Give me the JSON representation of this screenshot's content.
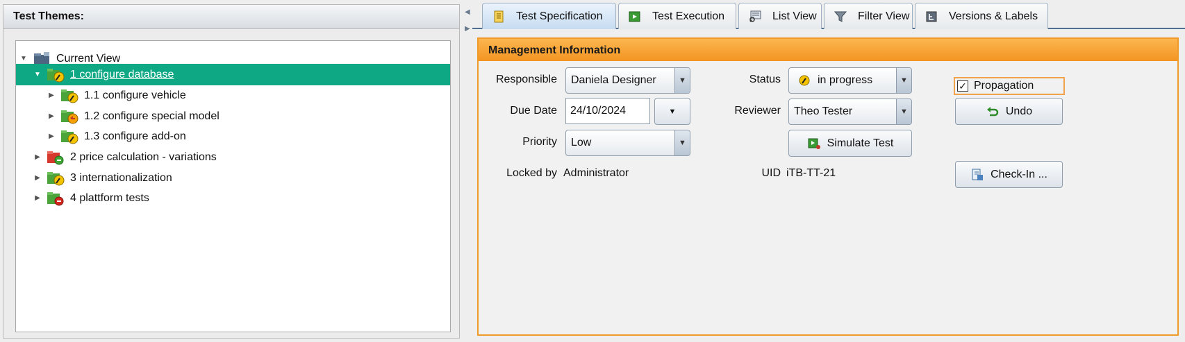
{
  "left_panel": {
    "title": "Test Themes:",
    "tree": [
      {
        "label": "Current View",
        "expanded": "▼",
        "icon": "view-icon"
      },
      {
        "label": "1 configure database",
        "expanded": "▼",
        "icon": "in-progress-theme-icon"
      },
      {
        "label": "1.1 configure vehicle",
        "expanded": "▶",
        "icon": "in-progress-theme-icon"
      },
      {
        "label": "1.2 configure special model",
        "expanded": "▶",
        "icon": "review-theme-icon"
      },
      {
        "label": "1.3 configure add-on",
        "expanded": "▶",
        "icon": "in-progress-theme-icon"
      },
      {
        "label": "2 price calculation - variations",
        "expanded": "▶",
        "icon": "new-theme-icon"
      },
      {
        "label": "3 internationalization",
        "expanded": "▶",
        "icon": "in-progress-theme-icon"
      },
      {
        "label": "4 plattform tests",
        "expanded": "▶",
        "icon": "blocked-theme-icon"
      }
    ]
  },
  "tabs": [
    {
      "label": "Test Specification",
      "icon": "specification-icon"
    },
    {
      "label": "Test Execution",
      "icon": "execution-icon"
    },
    {
      "label": "List View",
      "icon": "list-view-icon"
    },
    {
      "label": "Filter View",
      "icon": "filter-icon"
    },
    {
      "label": "Versions & Labels",
      "icon": "versions-icon"
    }
  ],
  "management": {
    "title": "Management Information",
    "responsible_label": "Responsible",
    "responsible_value": "Daniela Designer",
    "due_date_label": "Due Date",
    "due_date_value": "24/10/2024",
    "priority_label": "Priority",
    "priority_value": "Low",
    "locked_by_label": "Locked by",
    "locked_by_value": "Administrator",
    "status_label": "Status",
    "status_value": "in progress",
    "reviewer_label": "Reviewer",
    "reviewer_value": "Theo Tester",
    "simulate_label": "Simulate Test",
    "uid_label": "UID",
    "uid_value": "iTB-TT-21",
    "propagation_label": "Propagation",
    "propagation_checked": true,
    "undo_label": "Undo",
    "checkin_label": "Check-In ..."
  },
  "colors": {
    "selection": "#0fa884",
    "panel_accent": "#f39422",
    "tab_active": "#c7dcf1"
  }
}
